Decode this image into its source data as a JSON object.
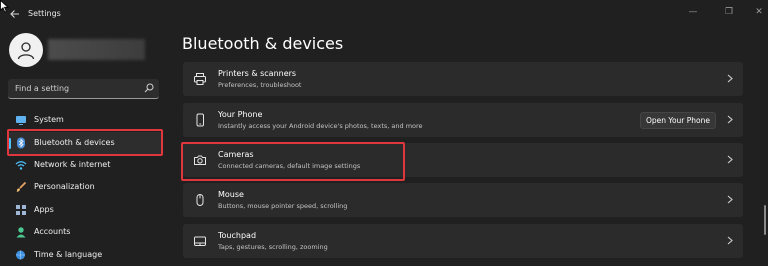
{
  "window": {
    "title": "Settings"
  },
  "sidebar": {
    "search_placeholder": "Find a setting",
    "items": [
      {
        "label": "System",
        "icon": "monitor-icon"
      },
      {
        "label": "Bluetooth & devices",
        "icon": "bluetooth-icon",
        "selected": true
      },
      {
        "label": "Network & internet",
        "icon": "wifi-icon"
      },
      {
        "label": "Personalization",
        "icon": "brush-icon"
      },
      {
        "label": "Apps",
        "icon": "apps-icon"
      },
      {
        "label": "Accounts",
        "icon": "person-icon"
      },
      {
        "label": "Time & language",
        "icon": "globe-clock-icon"
      }
    ]
  },
  "main": {
    "title": "Bluetooth & devices",
    "cards": [
      {
        "title": "Printers & scanners",
        "subtitle": "Preferences, troubleshoot",
        "icon": "printer-icon"
      },
      {
        "title": "Your Phone",
        "subtitle": "Instantly access your Android device's photos, texts, and more",
        "icon": "phone-icon",
        "button": "Open Your Phone"
      },
      {
        "title": "Cameras",
        "subtitle": "Connected cameras, default image settings",
        "icon": "camera-icon"
      },
      {
        "title": "Mouse",
        "subtitle": "Buttons, mouse pointer speed, scrolling",
        "icon": "mouse-icon"
      },
      {
        "title": "Touchpad",
        "subtitle": "Taps, gestures, scrolling, zooming",
        "icon": "touchpad-icon"
      }
    ]
  },
  "colors": {
    "background": "#202020",
    "card": "#2b2b2b",
    "accent": "#4cc2ff",
    "highlight": "#e0373f"
  }
}
